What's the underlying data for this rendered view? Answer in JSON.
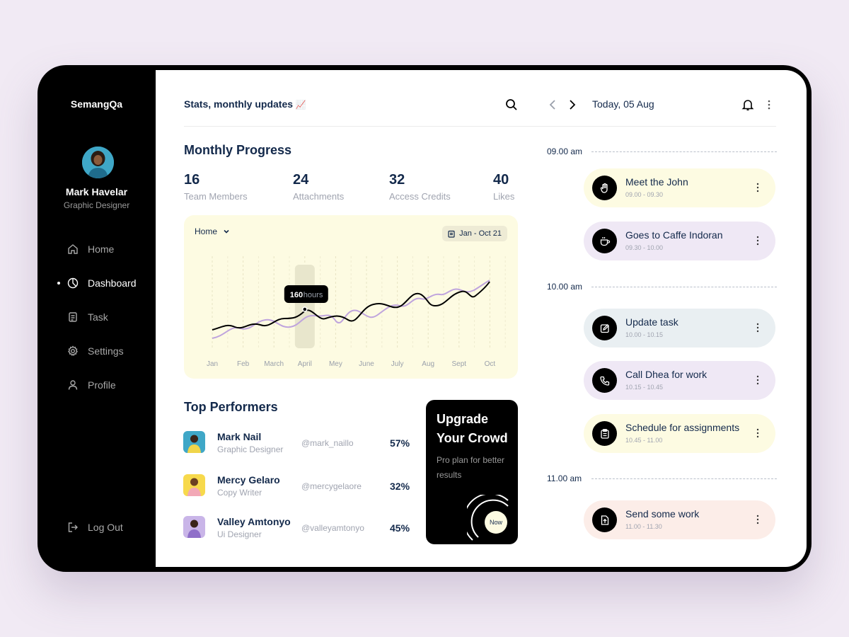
{
  "sidebar": {
    "brand": "SemangQa",
    "user": {
      "name": "Mark Havelar",
      "role": "Graphic Designer"
    },
    "items": [
      {
        "label": "Home",
        "icon": "home-icon",
        "active": false
      },
      {
        "label": "Dashboard",
        "icon": "pie-chart-icon",
        "active": true
      },
      {
        "label": "Task",
        "icon": "document-icon",
        "active": false
      },
      {
        "label": "Settings",
        "icon": "gear-icon",
        "active": false
      },
      {
        "label": "Profile",
        "icon": "user-icon",
        "active": false
      }
    ],
    "logout": "Log Out"
  },
  "header": {
    "title": "Stats, monthly updates",
    "emoji": "📈"
  },
  "progress": {
    "title": "Monthly Progress",
    "stats": [
      {
        "value": "16",
        "label": "Team Members"
      },
      {
        "value": "24",
        "label": "Attachments"
      },
      {
        "value": "32",
        "label": "Access Credits"
      },
      {
        "value": "40",
        "label": "Likes"
      }
    ]
  },
  "chart": {
    "dropdown": "Home",
    "date_range": "Jan - Oct 21",
    "tooltip_value": "160",
    "tooltip_unit": "hours"
  },
  "chart_data": {
    "type": "line",
    "x": [
      "Jan",
      "Feb",
      "March",
      "April",
      "Mey",
      "June",
      "July",
      "Aug",
      "Sept",
      "Oct"
    ],
    "highlight": "April",
    "tooltip": "160 hours"
  },
  "performers": {
    "title": "Top Performers",
    "items": [
      {
        "name": "Mark Nail",
        "role": "Graphic Designer",
        "handle": "@mark_naillo",
        "percent": "57%",
        "color": "#3fa7c7"
      },
      {
        "name": "Mercy Gelaro",
        "role": "Copy Writer",
        "handle": "@mercygelaore",
        "percent": "32%",
        "color": "#f7d94c"
      },
      {
        "name": "Valley Amtonyo",
        "role": "Ui Designer",
        "handle": "@valleyamtonyo",
        "percent": "45%",
        "color": "#c9b5e8"
      }
    ]
  },
  "upgrade": {
    "title_line1": "Upgrade",
    "title_line2": "Your Crowd",
    "subtitle": "Pro plan for better results",
    "button": "Now"
  },
  "schedule": {
    "date": "Today, 05 Aug",
    "slots": [
      {
        "time": "09.00 am"
      },
      {
        "time": "10.00 am"
      },
      {
        "time": "11.00 am"
      }
    ],
    "events": [
      {
        "title": "Meet the John",
        "time": "09.00 - 09.30",
        "icon": "hand-icon",
        "bg": "#fdfbe2"
      },
      {
        "title": "Goes to Caffe Indoran",
        "time": "09.30 - 10.00",
        "icon": "coffee-icon",
        "bg": "#efe8f5"
      },
      {
        "title": "Update task",
        "time": "10.00 - 10.15",
        "icon": "edit-icon",
        "bg": "#e9eff2"
      },
      {
        "title": "Call Dhea for work",
        "time": "10.15 - 10.45",
        "icon": "phone-icon",
        "bg": "#efe8f5"
      },
      {
        "title": "Schedule for assignments",
        "time": "10.45 - 11.00",
        "icon": "clipboard-icon",
        "bg": "#fdfbe2"
      },
      {
        "title": "Send some work",
        "time": "11.00 - 11.30",
        "icon": "upload-file-icon",
        "bg": "#fcede8"
      }
    ]
  }
}
